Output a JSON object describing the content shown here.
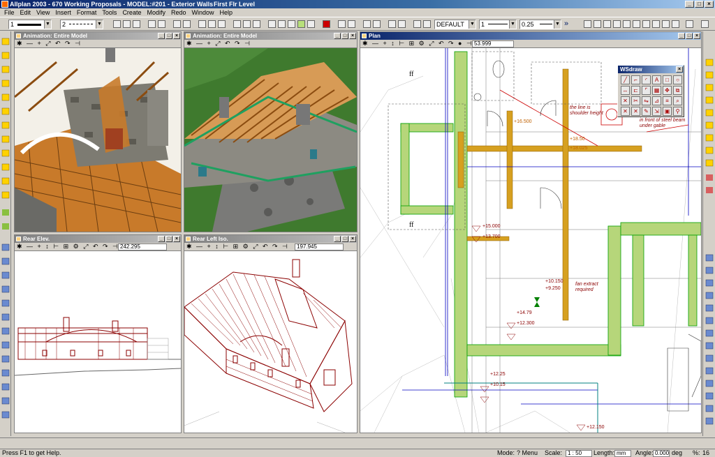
{
  "window": {
    "title": "Allplan 2003 - 670 Working Proposals - MODEL:#201 - Exterior Walls",
    "level": "First Flr Level",
    "minimize": "_",
    "maximize": "□",
    "close": "×"
  },
  "menu": [
    "File",
    "Edit",
    "View",
    "Insert",
    "Format",
    "Tools",
    "Create",
    "Modify",
    "Redo",
    "Window",
    "Help"
  ],
  "toolbar": {
    "pen_value": "1",
    "line_value": "2",
    "layer_value": "DEFAULT",
    "pen2_value": "1",
    "thickness_value": "0.25",
    "more": "»"
  },
  "viewports": {
    "anim1": {
      "title": "Animation: Entire Model"
    },
    "anim2": {
      "title": "Animation: Entire Model"
    },
    "rear": {
      "title": "Rear Elev.",
      "zoom": "242.295"
    },
    "rearleft": {
      "title": "Rear Left Iso.",
      "zoom": "197.945"
    },
    "plan": {
      "title": "Plan",
      "zoom": "53.999"
    }
  },
  "plan_annotations": {
    "a1": "ff",
    "a2": "ff",
    "l1": "+15.000",
    "l2": "+13.700",
    "l3": "+14.79",
    "l4": "+12.300",
    "l5": "+10.150",
    "l6": "+9.250",
    "l7": "+12.25",
    "l8": "+10.15",
    "l9": "+12.150",
    "n1": "the line is shoulder height",
    "n2": "in front of steel beam under gable",
    "n3": "fan extract required",
    "d1": "+18.50",
    "d2": "+18.025",
    "d3": "+16.500"
  },
  "wsdraw": {
    "title": "WSdraw"
  },
  "status": {
    "help": "Press F1 to get Help.",
    "mode_label": "Mode:",
    "mode_value": "? Menu",
    "scale_label": "Scale:",
    "scale_value": "1 : 50",
    "length_label": "Length:",
    "length_value": "mm",
    "angle_label": "Angle:",
    "angle_value": "0.000",
    "angle_unit": "deg",
    "percent_label": "%:",
    "percent_value": "16"
  },
  "colors": {
    "title_active": "#0a246a",
    "chrome": "#d4d0c8",
    "wall_green": "#b6d67a",
    "cad_red": "#8b0000",
    "timber": "#c8802a"
  }
}
